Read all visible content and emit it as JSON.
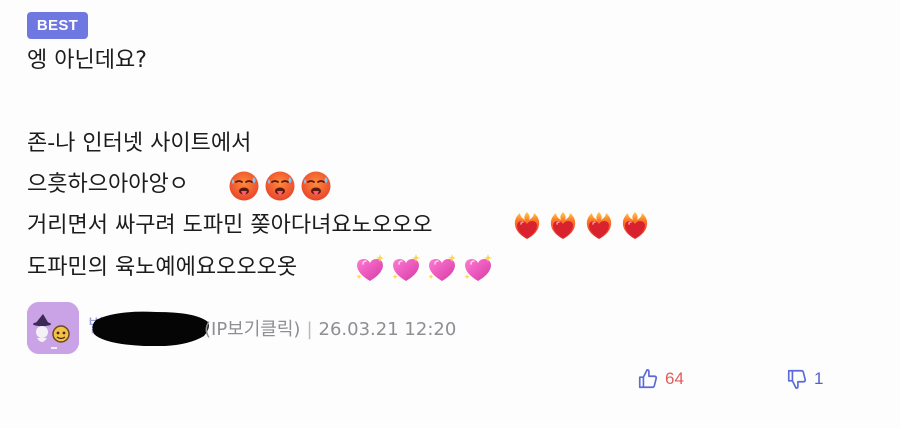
{
  "comment": {
    "badge": "BEST",
    "lines": [
      "엥 아닌데요?",
      "존-나 인터넷 사이트에서",
      "으흣하으아아앙ㅇ",
      "거리면서 싸구려 도파민 쫒아다녀요노오오오",
      "도파민의 육노예에요오오오옷"
    ],
    "emoji": {
      "line3": [
        "hot-face",
        "hot-face",
        "hot-face"
      ],
      "line4": [
        "heart-on-fire",
        "heart-on-fire",
        "heart-on-fire",
        "heart-on-fire"
      ],
      "line5": [
        "sparkling-heart",
        "sparkling-heart",
        "sparkling-heart",
        "sparkling-heart"
      ]
    }
  },
  "author": {
    "nickname": "",
    "ip_link": "(IP보기클릭)",
    "separator": "|",
    "date": "26.03.21 12:20"
  },
  "votes": {
    "up": "64",
    "down": "1"
  },
  "colors": {
    "badge": "#6f78e0",
    "upvote": "#e25b5b",
    "downvote": "#5660cf",
    "meta": "#8e8e93",
    "avatar_bg": "#c9a3e6"
  }
}
